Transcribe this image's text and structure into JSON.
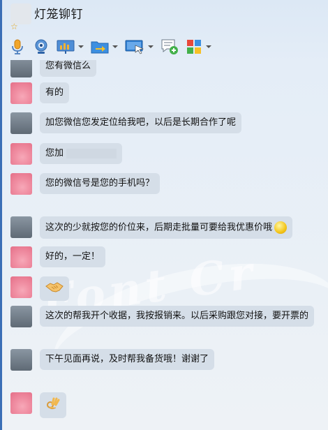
{
  "header": {
    "contact_name": "灯笼铆钉",
    "star": "☆"
  },
  "toolbar": {
    "icons": [
      "microphone-icon",
      "webcam-icon",
      "presentation-icon",
      "file-transfer-icon",
      "screen-share-icon",
      "sms-icon",
      "apps-icon"
    ]
  },
  "messages": [
    {
      "sender": "other",
      "text": "您有微信么"
    },
    {
      "sender": "self",
      "text": "有的"
    },
    {
      "sender": "other",
      "text": "加您微信您发定位给我吧，以后是长期合作了呢"
    },
    {
      "sender": "self",
      "text": "您加"
    },
    {
      "sender": "self",
      "text": "您的微信号是您的手机吗？"
    },
    {
      "sender": "other",
      "text": "这次的少就按您的价位来，后期走批量可要给我优惠价哦"
    },
    {
      "sender": "self",
      "text": "好的，一定！"
    },
    {
      "sender": "self",
      "emoji": "handshake"
    },
    {
      "sender": "other",
      "text": "这次的帮我开个收据，我按报销来。以后采购跟您对接，要开票的"
    },
    {
      "sender": "other",
      "text": "下午见面再说，及时帮我备货哦！谢谢了"
    },
    {
      "sender": "self",
      "emoji": "ok-hand"
    }
  ]
}
